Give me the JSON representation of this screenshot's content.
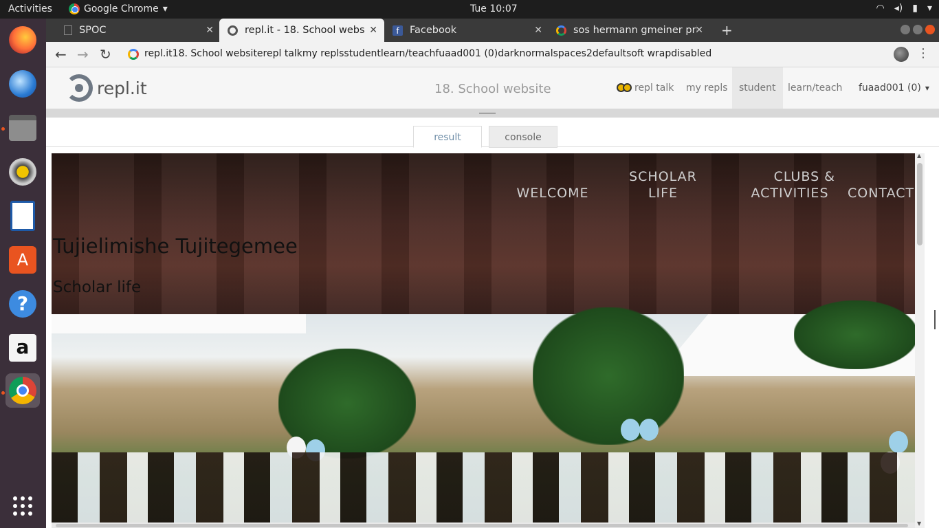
{
  "topbar": {
    "activities": "Activities",
    "app_name": "Google Chrome",
    "clock": "Tue 10:07",
    "dropdown_glyph": "▾"
  },
  "dock": {
    "items": [
      "firefox-icon",
      "thunderbird-icon",
      "files-icon",
      "rhythmbox-icon",
      "writer-icon",
      "software-center-icon",
      "help-icon",
      "amazon-icon",
      "chrome-icon",
      "show-apps-icon"
    ]
  },
  "browser": {
    "tabs": [
      {
        "title": "SPOC",
        "close": "✕"
      },
      {
        "title": "repl.it - 18. School website",
        "close": "✕"
      },
      {
        "title": "Facebook",
        "close": "✕"
      },
      {
        "title": "sos hermann gmeiner pri",
        "close": "✕"
      }
    ],
    "new_tab": "+",
    "url": "repl.it18. School websiterepl talkmy replsstudentlearn/teachfuaad001 (0)darknormalspaces2defaultsoft wrapdisabled",
    "back": "←",
    "forward": "→",
    "reload": "↻",
    "menu": "⋮"
  },
  "repl": {
    "logo_text": "repl.it",
    "project_title": "18. School website",
    "nav": {
      "talk": "repl talk",
      "my_repls": "my repls",
      "student": "student",
      "learn_teach": "learn/teach",
      "user": "fuaad001 (0)",
      "user_caret": "▾"
    },
    "tabs": {
      "result": "result",
      "console": "console"
    }
  },
  "site": {
    "nav": {
      "welcome": "WELCOME",
      "scholar_line1": "SCHOLAR",
      "scholar_line2": "LIFE",
      "clubs_line1": "CLUBS &",
      "clubs_line2": "ACTIVITIES",
      "contacts": "CONTACTS"
    },
    "heading": "Tujielimishe Tujitegemee",
    "subheading": "Scholar life"
  },
  "colors": {
    "accent_orange": "#e95420",
    "repl_tab_active_text": "#6f8ea8"
  }
}
